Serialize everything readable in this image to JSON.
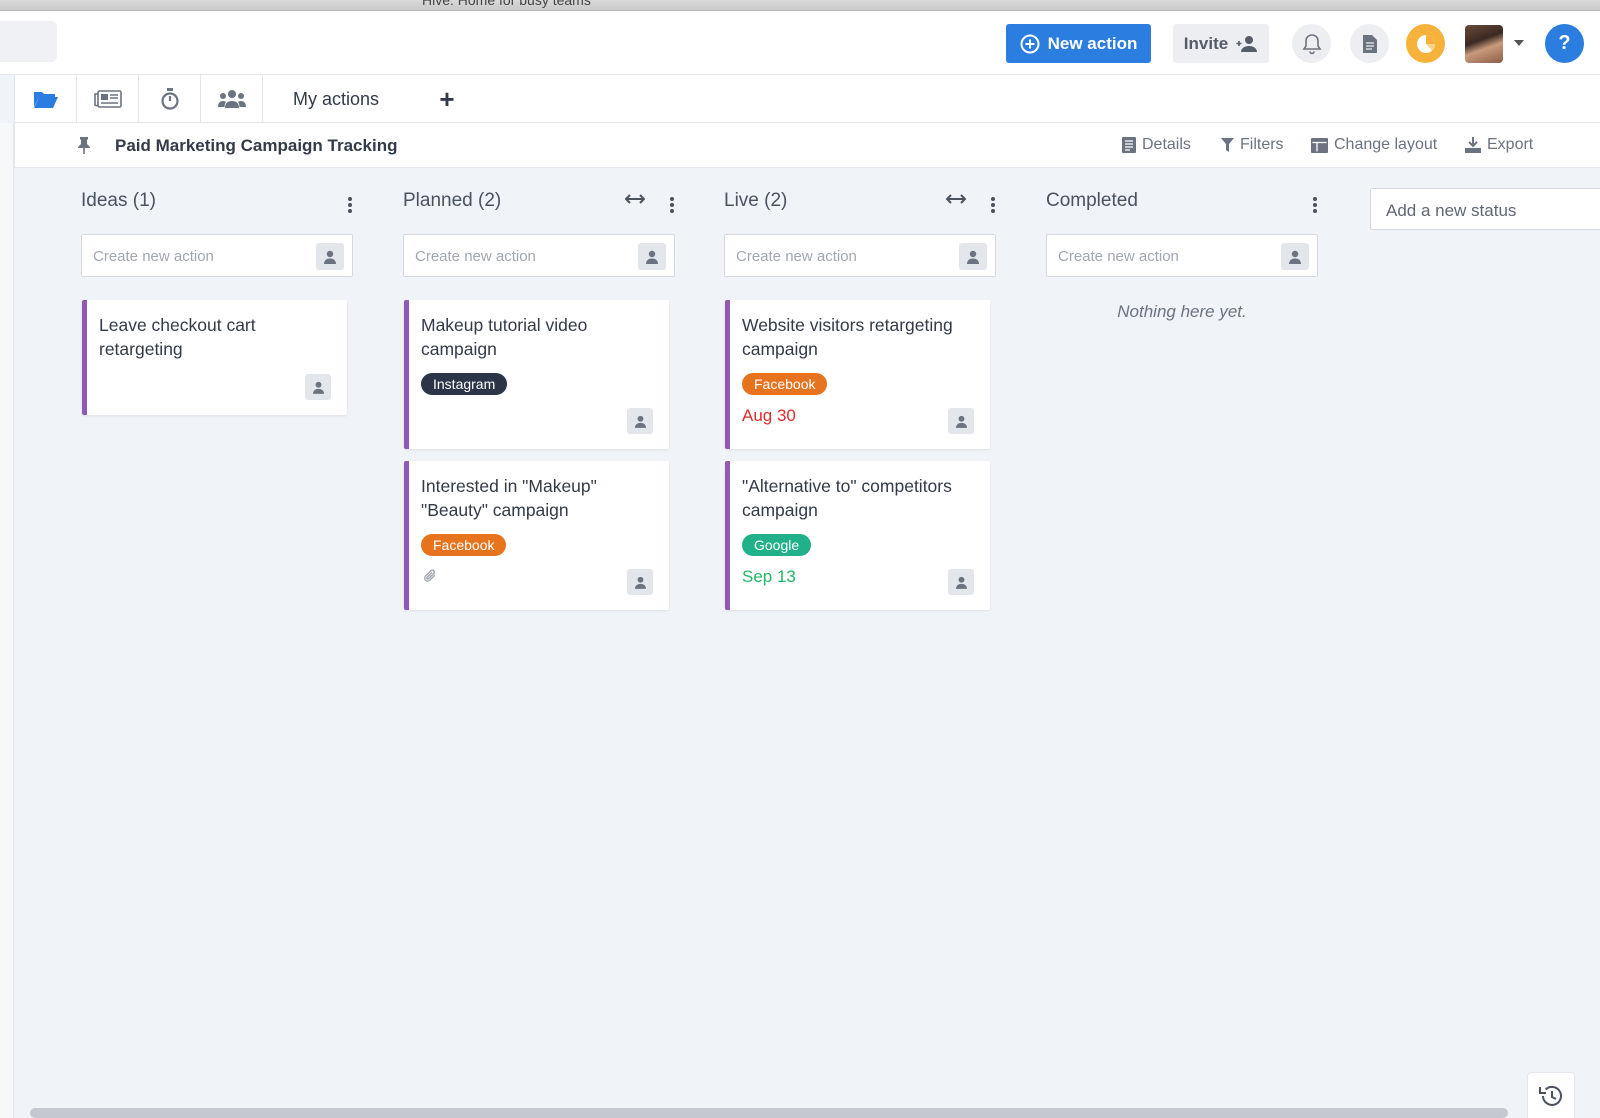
{
  "window": {
    "title": "Hive: Home for busy teams"
  },
  "header": {
    "new_action_label": "New action",
    "invite_label": "Invite"
  },
  "tabs": {
    "my_actions_label": "My actions",
    "add_label": "+"
  },
  "project": {
    "title": "Paid Marketing Campaign Tracking",
    "tools": {
      "details": "Details",
      "filters": "Filters",
      "change_layout": "Change layout",
      "export": "Export"
    }
  },
  "board": {
    "create_placeholder": "Create new action",
    "add_status_placeholder": "Add a new status",
    "empty_text": "Nothing here yet.",
    "columns": [
      {
        "title": "Ideas (1)",
        "cards": [
          {
            "title": "Leave checkout cart retargeting"
          }
        ]
      },
      {
        "title": "Planned (2)",
        "cards": [
          {
            "title": "Makeup tutorial video campaign",
            "tag": "Instagram"
          },
          {
            "title": "Interested in \"Makeup\" \"Beauty\" campaign",
            "tag": "Facebook",
            "attachment": true
          }
        ]
      },
      {
        "title": "Live (2)",
        "cards": [
          {
            "title": "Website visitors retargeting campaign",
            "tag": "Facebook",
            "due": "Aug 30"
          },
          {
            "title": "\"Alternative to\" competitors campaign",
            "tag": "Google",
            "due": "Sep 13"
          }
        ]
      },
      {
        "title": "Completed",
        "cards": []
      }
    ]
  },
  "colors": {
    "primary": "#2b7de0",
    "card_accent": "#8e5ab5",
    "tag_instagram": "#2c3547",
    "tag_facebook": "#e8731e",
    "tag_google": "#21b18a",
    "due_overdue": "#e02b2b",
    "due_upcoming": "#21b864"
  },
  "icons": [
    "folder-icon",
    "newspaper-icon",
    "timer-icon",
    "team-icon",
    "pin-icon",
    "bell-icon",
    "document-icon",
    "pie-icon",
    "user-icon",
    "history-icon",
    "paperclip-icon"
  ]
}
